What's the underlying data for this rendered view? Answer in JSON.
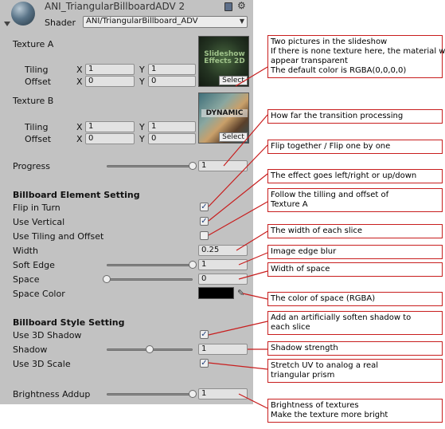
{
  "header": {
    "title": "ANI_TriangularBillboardADV 2",
    "shader_label": "Shader",
    "shader_value": "ANI/TriangularBillboard_ADV"
  },
  "texture_a": {
    "label": "Texture A",
    "tiling_label": "Tiling",
    "offset_label": "Offset",
    "x_label": "X",
    "y_label": "Y",
    "tiling_x": "1",
    "tiling_y": "1",
    "offset_x": "0",
    "offset_y": "0",
    "thumb_text": "Slideshow Effects 2D",
    "select_label": "Select"
  },
  "texture_b": {
    "label": "Texture B",
    "tiling_label": "Tiling",
    "offset_label": "Offset",
    "x_label": "X",
    "y_label": "Y",
    "tiling_x": "1",
    "tiling_y": "1",
    "offset_x": "0",
    "offset_y": "0",
    "thumb_text": "DYNAMIC",
    "select_label": "Select"
  },
  "progress": {
    "label": "Progress",
    "value": "1",
    "level": 1.0
  },
  "billboard_element": {
    "heading": "Billboard Element Setting",
    "flip_in_turn": {
      "label": "Flip in Turn",
      "checked": true
    },
    "use_vertical": {
      "label": "Use Vertical",
      "checked": true
    },
    "use_tiling_offset": {
      "label": "Use Tiling and Offset",
      "checked": false
    },
    "width": {
      "label": "Width",
      "value": "0.25"
    },
    "soft_edge": {
      "label": "Soft Edge",
      "value": "1",
      "level": 1.0
    },
    "space": {
      "label": "Space",
      "value": "0",
      "level": 0.0
    },
    "space_color": {
      "label": "Space Color",
      "color": "#000000"
    }
  },
  "billboard_style": {
    "heading": "Billboard Style Setting",
    "use_3d_shadow": {
      "label": "Use 3D Shadow",
      "checked": true
    },
    "shadow": {
      "label": "Shadow",
      "value": "1",
      "level": 0.5
    },
    "use_3d_scale": {
      "label": "Use 3D Scale",
      "checked": true
    },
    "brightness": {
      "label": "Brightness Addup",
      "value": "1",
      "level": 1.0
    }
  },
  "annotations": {
    "texture": [
      "Two pictures in the slideshow",
      "If there is none texture here, the material will",
      "appear transparent",
      "The default color is RGBA(0,0,0,0)"
    ],
    "progress": [
      "How far the transition processing"
    ],
    "flip": [
      "Flip together / Flip one by one"
    ],
    "vertical": [
      "The effect goes left/right or up/down"
    ],
    "tiling": [
      "Follow the tilling and offset of",
      "Texture A"
    ],
    "width": [
      "The width of each slice"
    ],
    "soft_edge": [
      "Image edge blur"
    ],
    "space": [
      "Width of space"
    ],
    "space_color": [
      "The color of space (RGBA)"
    ],
    "shadow3d": [
      "Add an artificially soften shadow to",
      "each slice"
    ],
    "shadow": [
      "Shadow strength"
    ],
    "scale": [
      "Stretch UV to analog a real",
      "triangular prism"
    ],
    "brightness": [
      "Brightness of textures",
      "Make the texture more bright"
    ]
  },
  "colors": {
    "panel": "#c2c2c2",
    "annotation_border": "#c81e1e",
    "arrow": "#c81e1e",
    "checkmark": "#1f3f7a"
  },
  "icons": {
    "material": "material-sphere-icon",
    "help": "help-book-icon",
    "settings": "gear-icon",
    "fold": "triangle-down-icon",
    "dropdown": "chevron-down-icon",
    "eyedropper": "eyedropper-icon"
  }
}
